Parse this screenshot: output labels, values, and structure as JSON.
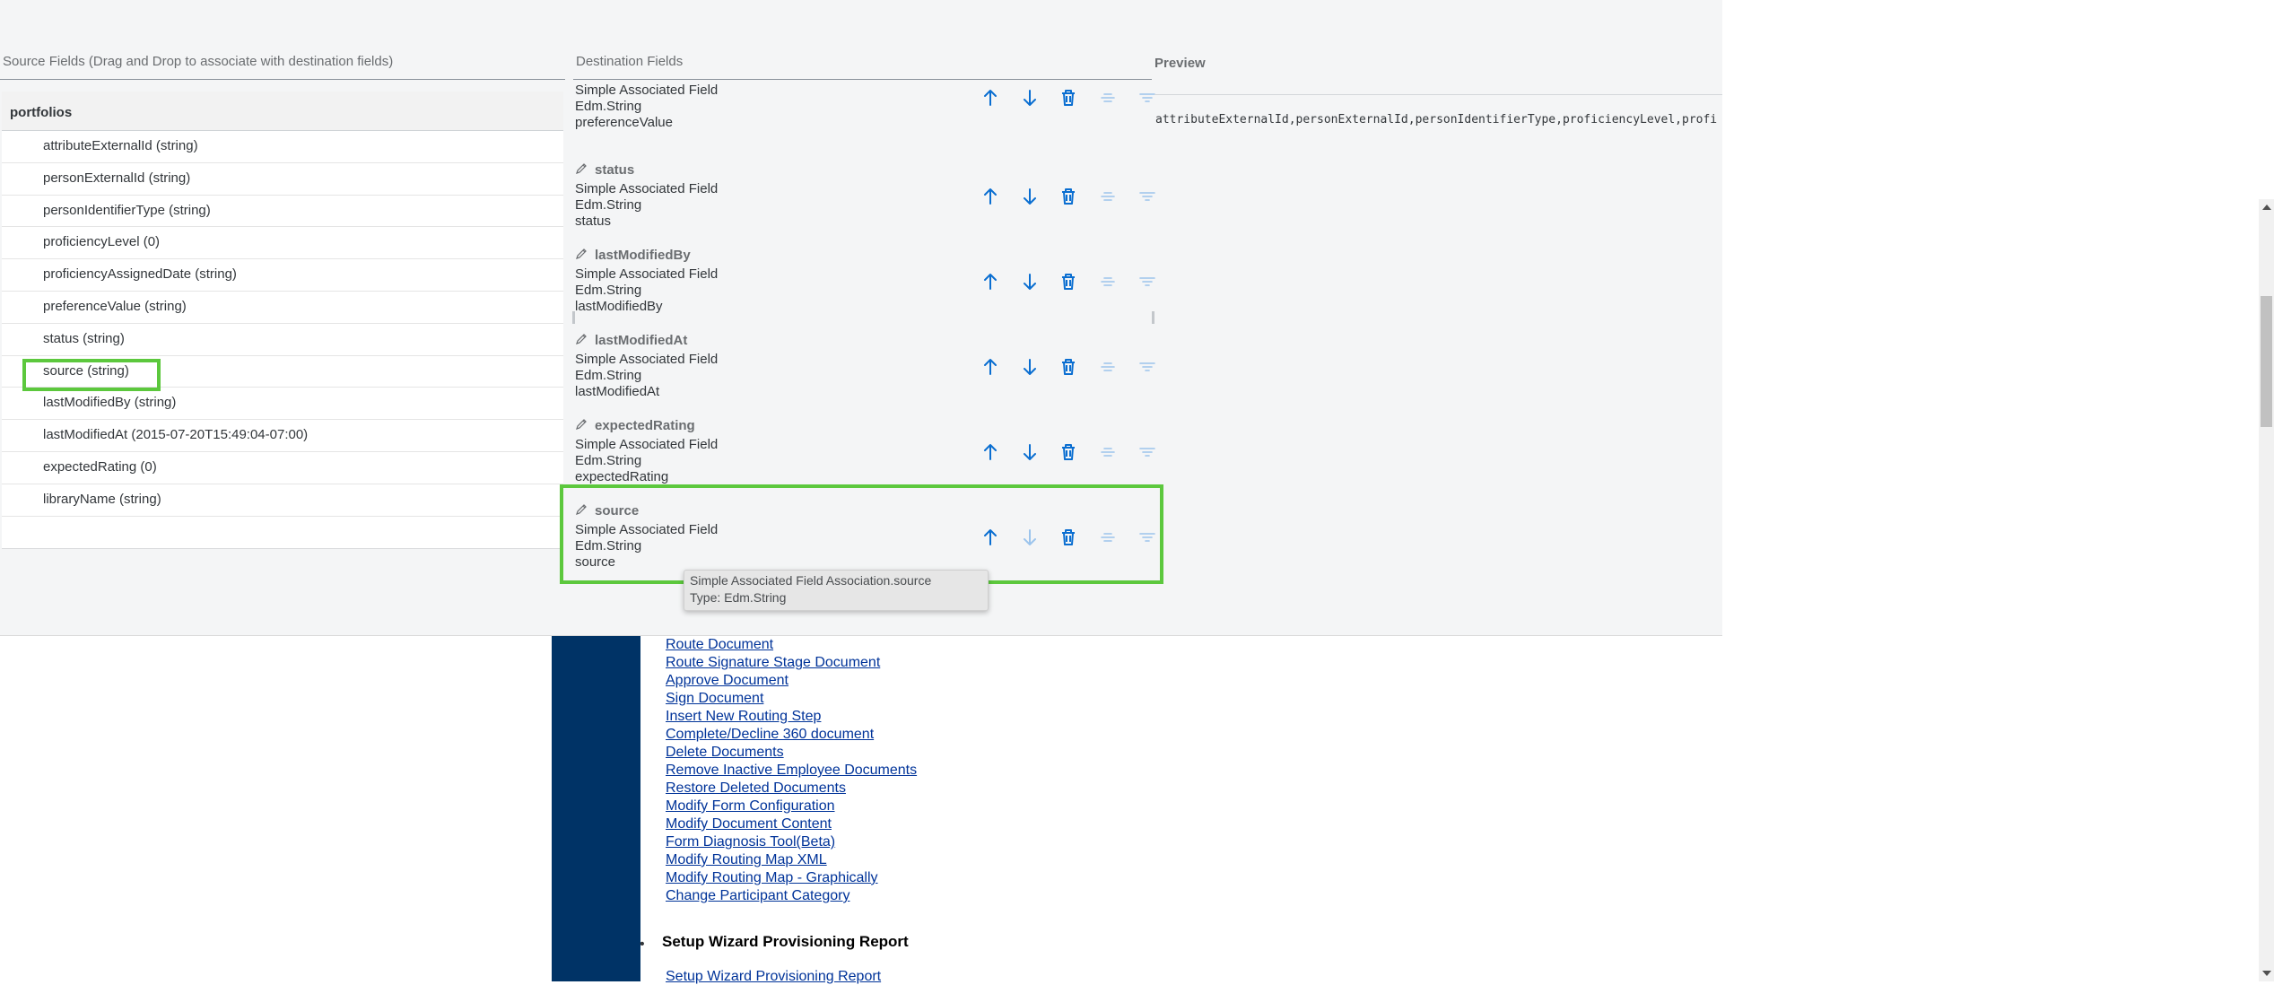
{
  "source": {
    "header": "Source Fields (Drag and Drop to associate with destination fields)",
    "group": "portfolios",
    "fields": [
      "attributeExternalId (string)",
      "personExternalId (string)",
      "personIdentifierType (string)",
      "proficiencyLevel (0)",
      "proficiencyAssignedDate (string)",
      "preferenceValue (string)",
      "status (string)",
      "source (string)",
      "lastModifiedBy (string)",
      "lastModifiedAt (2015-07-20T15:49:04-07:00)",
      "expectedRating (0)",
      "libraryName (string)"
    ]
  },
  "destination": {
    "header": "Destination Fields",
    "items": [
      {
        "name": "",
        "kind": "Simple Associated Field",
        "type": "Edm.String",
        "source": "preferenceValue"
      },
      {
        "name": "status",
        "kind": "Simple Associated Field",
        "type": "Edm.String",
        "source": "status"
      },
      {
        "name": "lastModifiedBy",
        "kind": "Simple Associated Field",
        "type": "Edm.String",
        "source": "lastModifiedBy"
      },
      {
        "name": "lastModifiedAt",
        "kind": "Simple Associated Field",
        "type": "Edm.String",
        "source": "lastModifiedAt"
      },
      {
        "name": "expectedRating",
        "kind": "Simple Associated Field",
        "type": "Edm.String",
        "source": "expectedRating"
      },
      {
        "name": "source",
        "kind": "Simple Associated Field",
        "type": "Edm.String",
        "source": "source"
      }
    ],
    "icons": [
      "move-up-icon",
      "move-down-icon",
      "delete-icon",
      "align-center-icon",
      "filter-icon"
    ]
  },
  "preview": {
    "header": "Preview",
    "text": "attributeExternalId,personExternalId,personIdentifierType,proficiencyLevel,profi"
  },
  "tooltip": {
    "line1": "Simple Associated Field  Association.source",
    "line2": "Type: Edm.String"
  },
  "legacy": {
    "links": [
      "Route Document",
      "Route Signature Stage Document",
      "Approve Document",
      "Sign Document",
      "Insert New Routing Step",
      "Complete/Decline 360 document",
      "Delete Documents",
      "Remove Inactive Employee Documents",
      "Restore Deleted Documents",
      "Modify Form Configuration",
      "Modify Document Content",
      "Form Diagnosis Tool(Beta)",
      "Modify Routing Map XML",
      "Modify Routing Map - Graphically",
      "Change Participant Category"
    ],
    "section_title": "Setup Wizard Provisioning Report",
    "section_link": "Setup Wizard Provisioning Report"
  },
  "colors": {
    "accent": "#0a6ed1",
    "highlight": "#5cc83d",
    "legacy_bar": "#003366",
    "link": "#003399"
  }
}
